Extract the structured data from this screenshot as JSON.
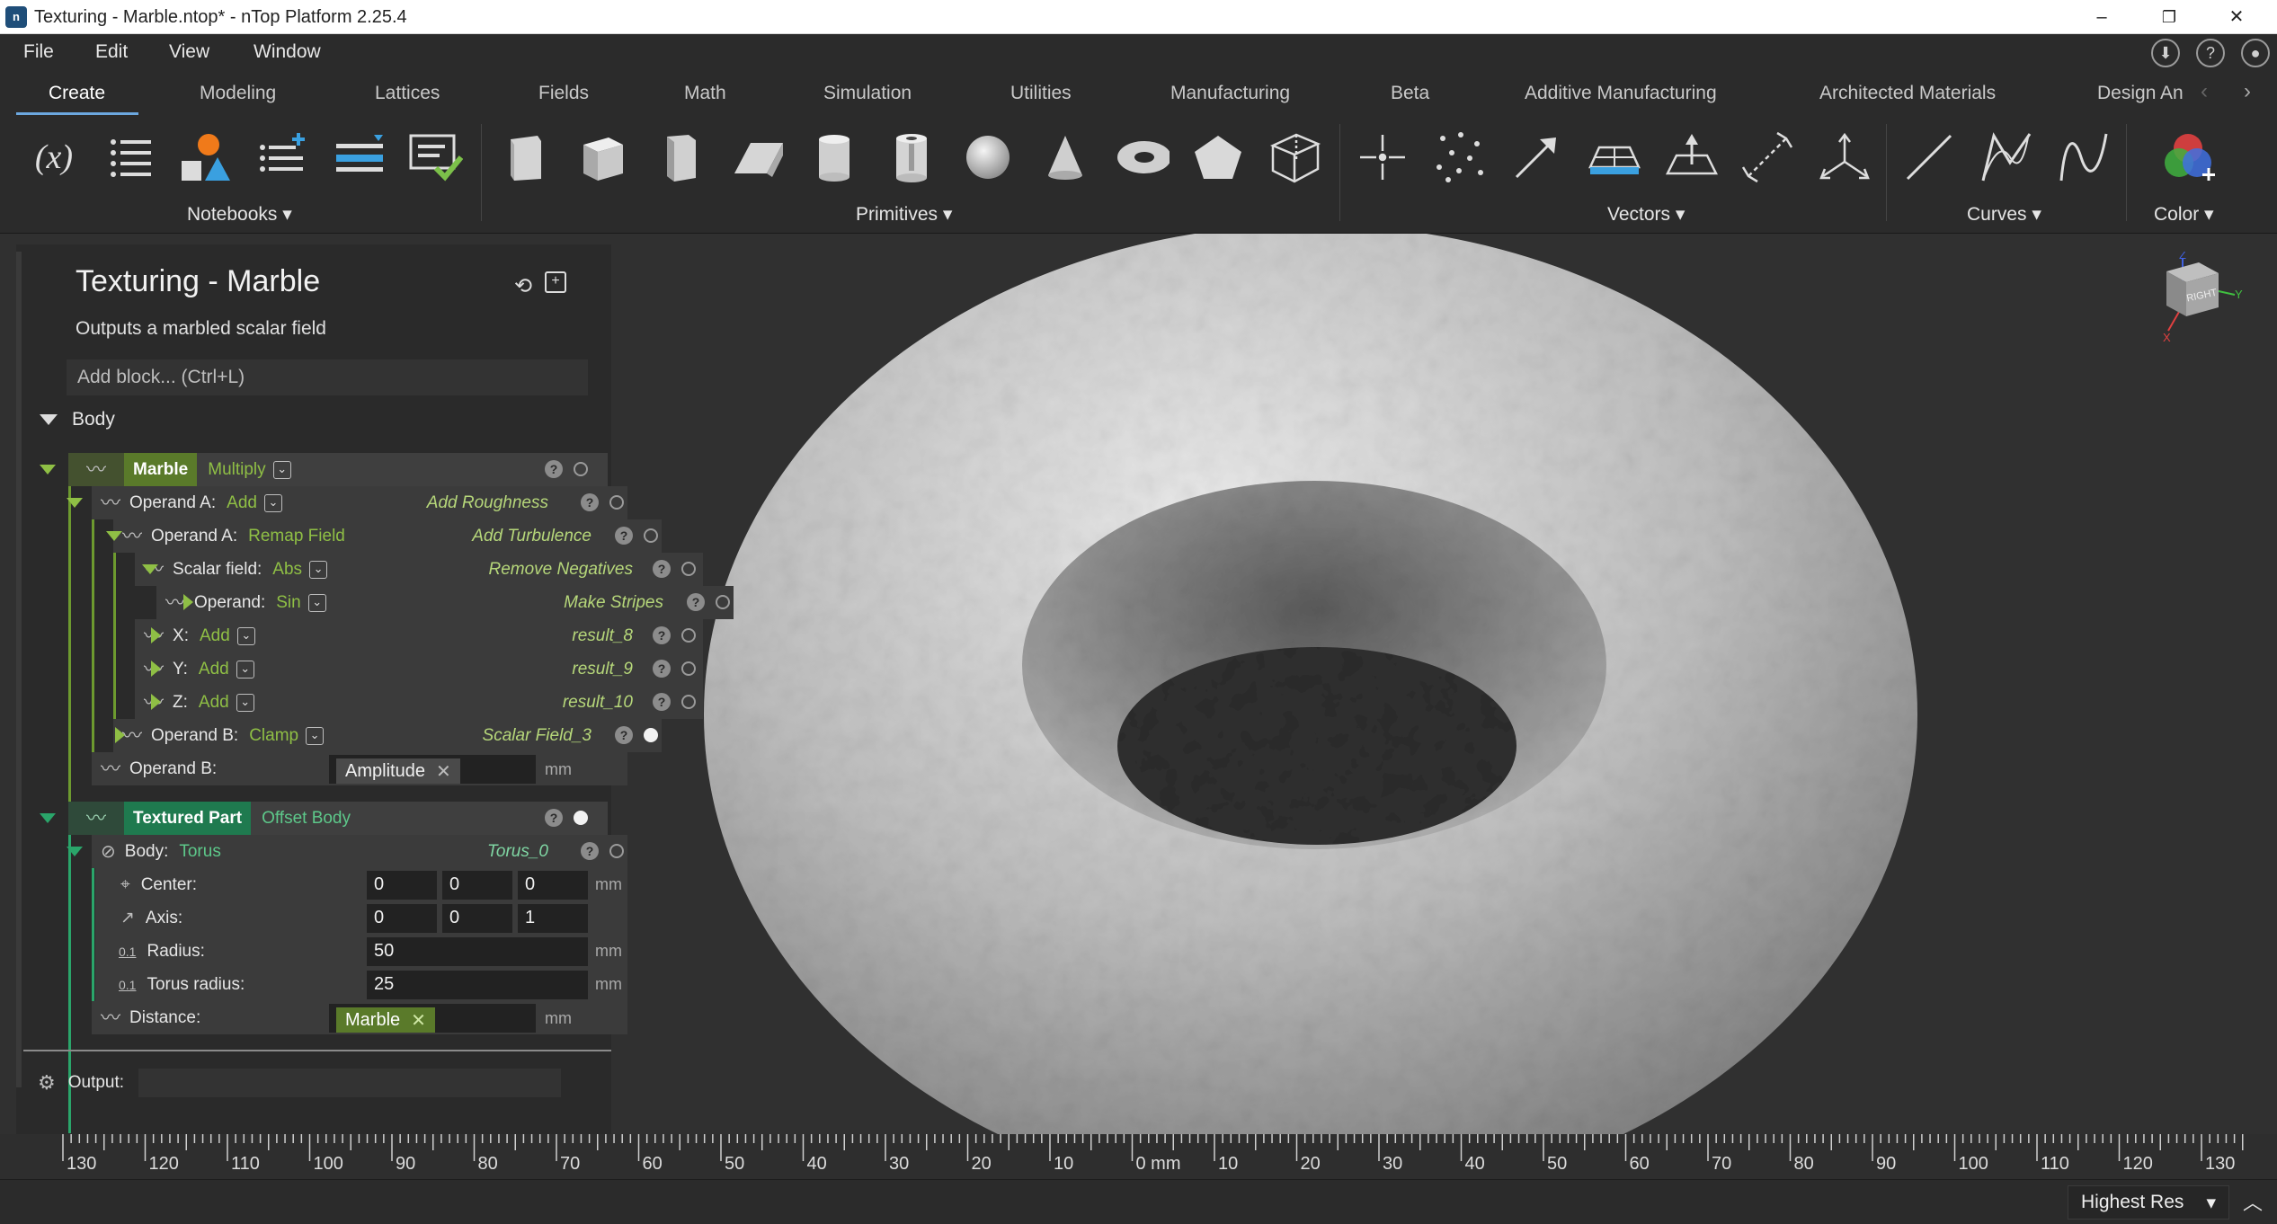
{
  "window": {
    "title": "Texturing - Marble.ntop* - nTop Platform 2.25.4",
    "controls": [
      "–",
      "❐",
      "✕"
    ]
  },
  "menu": {
    "items": [
      "File",
      "Edit",
      "View",
      "Window"
    ],
    "right_icons": [
      "download-icon",
      "help-icon",
      "account-icon"
    ]
  },
  "ribbon": {
    "tabs": [
      "Create",
      "Modeling",
      "Lattices",
      "Fields",
      "Math",
      "Simulation",
      "Utilities",
      "Manufacturing",
      "Beta",
      "Additive Manufacturing",
      "Architected Materials",
      "Design An"
    ],
    "active_tab": "Create",
    "groups": [
      "Notebooks",
      "Primitives",
      "Vectors",
      "Curves",
      "Color"
    ]
  },
  "notebook": {
    "title": "Texturing - Marble",
    "description": "Outputs a marbled scalar field",
    "add_block_placeholder": "Add block... (Ctrl+L)",
    "body_label": "Body",
    "blocks": {
      "marble": {
        "name": "Marble",
        "type": "Multiply"
      },
      "operand_a1": {
        "label": "Operand A:",
        "type": "Add",
        "ref": "Add Roughness"
      },
      "operand_a2": {
        "label": "Operand A:",
        "type": "Remap Field",
        "ref": "Add Turbulence"
      },
      "scalar_field": {
        "label": "Scalar field:",
        "type": "Abs",
        "ref": "Remove Negatives"
      },
      "operand": {
        "label": "Operand:",
        "type": "Sin",
        "ref": "Make Stripes"
      },
      "x": {
        "label": "X:",
        "type": "Add",
        "ref": "result_8"
      },
      "y": {
        "label": "Y:",
        "type": "Add",
        "ref": "result_9"
      },
      "z": {
        "label": "Z:",
        "type": "Add",
        "ref": "result_10"
      },
      "operand_b1": {
        "label": "Operand B:",
        "type": "Clamp",
        "ref": "Scalar Field_3"
      },
      "operand_b2": {
        "label": "Operand B:",
        "value": "Amplitude",
        "unit": "mm"
      },
      "textured_part": {
        "name": "Textured Part",
        "type": "Offset Body"
      },
      "body": {
        "label": "Body:",
        "type": "Torus",
        "ref": "Torus_0"
      },
      "center": {
        "label": "Center:",
        "values": [
          "0",
          "0",
          "0"
        ],
        "unit": "mm"
      },
      "axis": {
        "label": "Axis:",
        "values": [
          "0",
          "0",
          "1"
        ]
      },
      "radius": {
        "label": "Radius:",
        "value": "50",
        "unit": "mm",
        "icon_text": "0.1"
      },
      "torus_radius": {
        "label": "Torus radius:",
        "value": "25",
        "unit": "mm",
        "icon_text": "0.1"
      },
      "distance": {
        "label": "Distance:",
        "value": "Marble",
        "unit": "mm"
      }
    },
    "output_label": "Output:"
  },
  "view_cube": {
    "label": "RIGHT",
    "axes": [
      "X",
      "Y",
      "Z"
    ]
  },
  "ruler": {
    "ticks": [
      "130",
      "120",
      "110",
      "100",
      "90",
      "80",
      "70",
      "60",
      "50",
      "40",
      "30",
      "20",
      "10",
      "0 mm",
      "10",
      "20",
      "30",
      "40",
      "50",
      "60",
      "70",
      "80",
      "90",
      "100",
      "110",
      "120",
      "130"
    ]
  },
  "status": {
    "resolution": "Highest Res"
  },
  "colors": {
    "accent_green": "#8fbf45",
    "tab_underline": "#6ca8e0",
    "background": "#303030"
  }
}
